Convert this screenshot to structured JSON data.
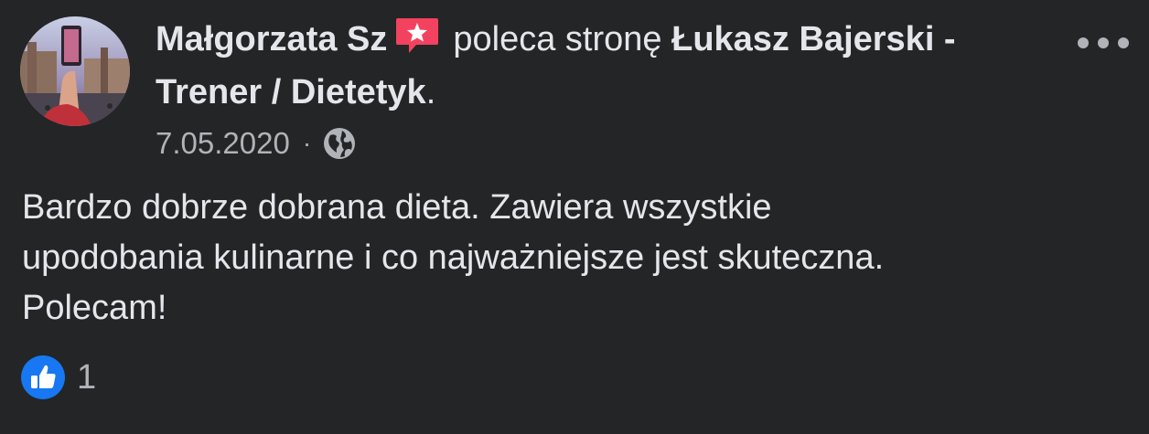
{
  "post": {
    "author_name": "Małgorzata Sz",
    "badge_icon": "recommendation-star-icon",
    "verb": "poleca stronę",
    "page_name": "Łukasz Bajerski - Trener / Dietetyk",
    "page_name_suffix": ".",
    "date": "7.05.2020",
    "separator": "·",
    "audience_icon": "globe-icon",
    "more_icon": "more-options-icon",
    "text_lines": [
      "Bardzo dobrze dobrana dieta. Zawiera wszystkie",
      "upodobania kulinarne i co najważniejsze jest skuteczna.",
      "Polecam!"
    ],
    "reaction_icon": "like-icon",
    "reaction_count": "1"
  },
  "colors": {
    "background": "#242526",
    "primary_text": "#e4e6eb",
    "secondary_text": "#b0b3b8",
    "badge_red": "#f3425f",
    "like_blue": "#1877f2"
  }
}
